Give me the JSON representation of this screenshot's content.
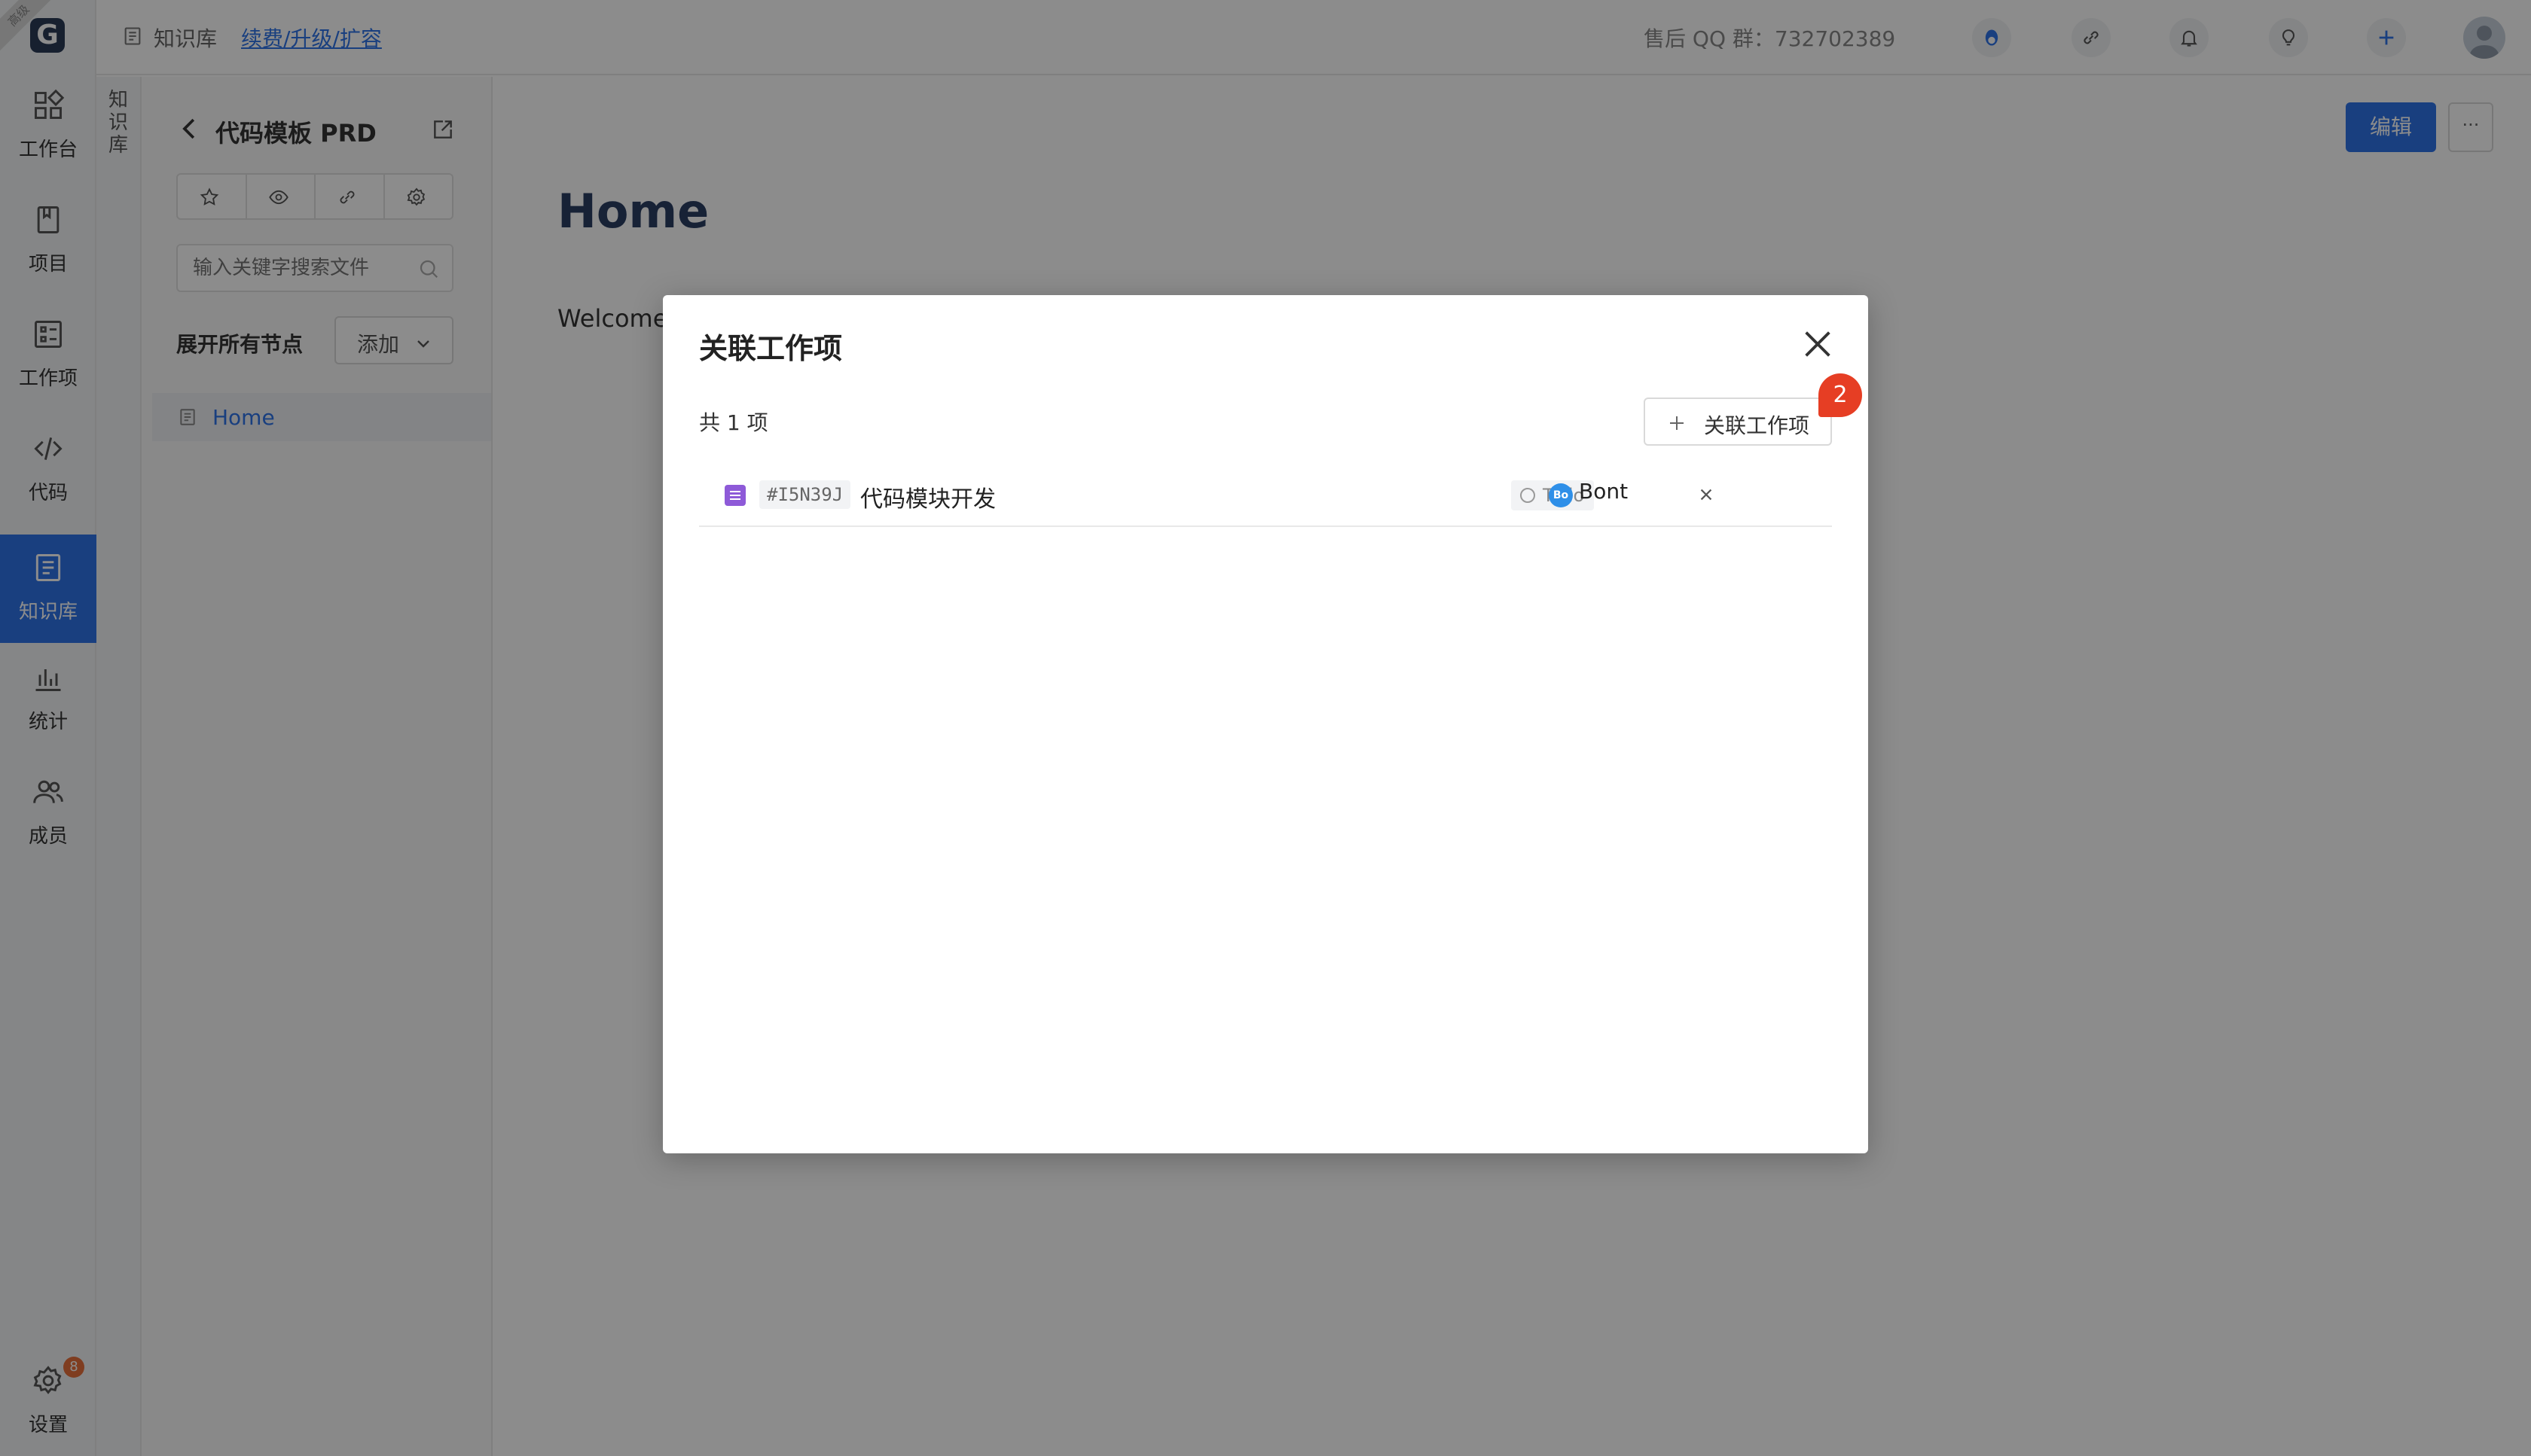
{
  "rail": {
    "logo_ribbon": "高级",
    "logo_letter": "G",
    "items": [
      {
        "label": "工作台",
        "icon": "dashboard-icon"
      },
      {
        "label": "项目",
        "icon": "book-icon"
      },
      {
        "label": "工作项",
        "icon": "task-list-icon"
      },
      {
        "label": "代码",
        "icon": "code-icon"
      },
      {
        "label": "知识库",
        "icon": "document-icon"
      },
      {
        "label": "统计",
        "icon": "bar-chart-icon"
      },
      {
        "label": "成员",
        "icon": "members-icon"
      }
    ],
    "settings": {
      "label": "设置",
      "badge": "8"
    },
    "active_index": 4
  },
  "col2_label": "知识库",
  "topbar": {
    "crumb": "知识库",
    "crumb_link": "续费/升级/扩容",
    "qq": "售后 QQ 群：732702389"
  },
  "tree": {
    "title": "代码模板 PRD",
    "search_placeholder": "输入关键字搜索文件",
    "expand_label": "展开所有节点",
    "add_label": "添加",
    "node_label": "Home"
  },
  "main": {
    "edit_label": "编辑",
    "more_label": "···",
    "title": "Home",
    "body": "Welcome"
  },
  "modal": {
    "title": "关联工作项",
    "count": "共 1 项",
    "link_button": "关联工作项",
    "step_badge": "2",
    "items": [
      {
        "id": "#I5N39J",
        "name": "代码模块开发",
        "status": "Todo",
        "assignee_initials": "Bo",
        "assignee": "Bont"
      }
    ]
  },
  "colors": {
    "accent": "#2e73e8",
    "badge": "#e63e24",
    "type_purple": "#8e5ad8"
  }
}
